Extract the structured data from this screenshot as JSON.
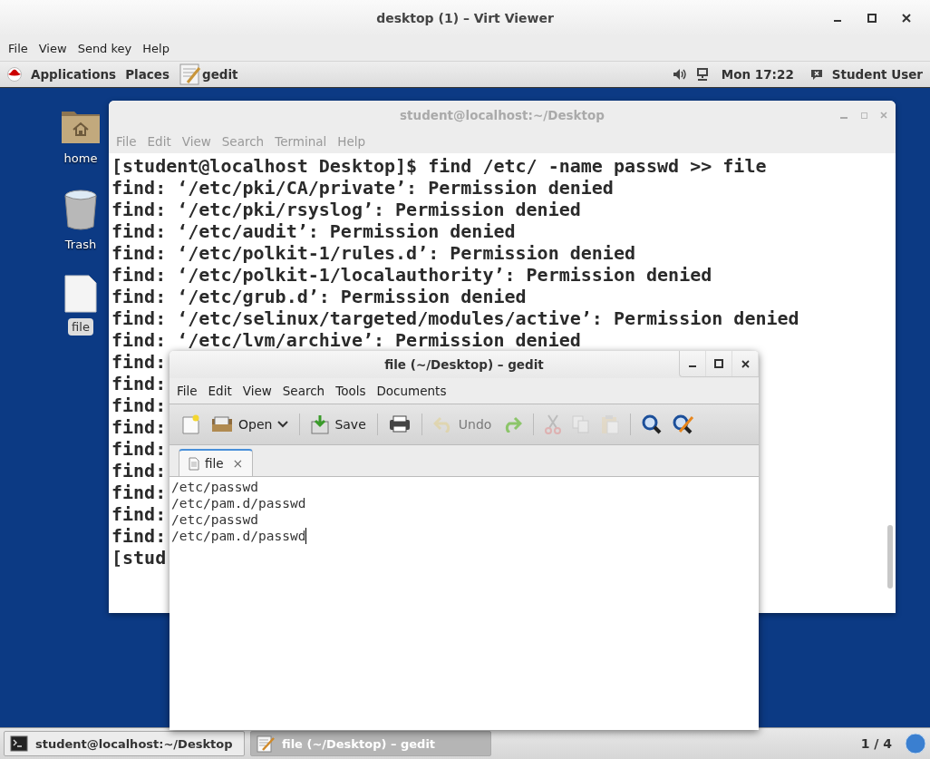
{
  "window": {
    "title": "desktop (1) – Virt Viewer",
    "menu": [
      "File",
      "View",
      "Send key",
      "Help"
    ]
  },
  "top_bar": {
    "applications": "Applications",
    "places": "Places",
    "app": "gedit",
    "clock": "Mon 17:22",
    "user": "Student User"
  },
  "desktop_icons": [
    {
      "kind": "folder",
      "label": "home",
      "selected": false
    },
    {
      "kind": "trash",
      "label": "Trash",
      "selected": false
    },
    {
      "kind": "file",
      "label": "file",
      "selected": true
    }
  ],
  "terminal": {
    "title": "student@localhost:~/Desktop",
    "menu": [
      "File",
      "Edit",
      "View",
      "Search",
      "Terminal",
      "Help"
    ],
    "lines": [
      "[student@localhost Desktop]$ find /etc/ -name passwd >> file",
      "find: ‘/etc/pki/CA/private’: Permission denied",
      "find: ‘/etc/pki/rsyslog’: Permission denied",
      "find: ‘/etc/audit’: Permission denied",
      "find: ‘/etc/polkit-1/rules.d’: Permission denied",
      "find: ‘/etc/polkit-1/localauthority’: Permission denied",
      "find: ‘/etc/grub.d’: Permission denied",
      "find: ‘/etc/selinux/targeted/modules/active’: Permission denied",
      "find: ‘/etc/lvm/archive’: Permission denied",
      "find:",
      "find:",
      "find:",
      "find:",
      "find:",
      "find:",
      "find:",
      "find:",
      "find:",
      "[stud"
    ]
  },
  "gedit": {
    "title": "file (~/Desktop) – gedit",
    "menu": [
      "File",
      "Edit",
      "View",
      "Search",
      "Tools",
      "Documents"
    ],
    "toolbar": [
      {
        "kind": "new",
        "disabled": false
      },
      {
        "kind": "open",
        "label": "Open",
        "disabled": false
      },
      {
        "kind": "save",
        "label": "Save",
        "disabled": false
      },
      {
        "kind": "print",
        "disabled": false
      },
      {
        "kind": "undo",
        "label": "Undo",
        "disabled": true
      },
      {
        "kind": "redo",
        "disabled": false
      },
      {
        "kind": "cut",
        "disabled": true
      },
      {
        "kind": "copy",
        "disabled": true
      },
      {
        "kind": "paste",
        "disabled": true
      },
      {
        "kind": "find",
        "disabled": false
      },
      {
        "kind": "replace",
        "disabled": false
      }
    ],
    "tabs": [
      {
        "label": "file",
        "close": "×",
        "selected": true
      }
    ],
    "lines": [
      "/etc/passwd",
      "/etc/pam.d/passwd",
      "/etc/passwd",
      "/etc/pam.d/passwd"
    ]
  },
  "taskbar": {
    "items": [
      {
        "kind": "terminal",
        "label": "student@localhost:~/Desktop",
        "selected": false
      },
      {
        "kind": "editor",
        "label": "file (~/Desktop) – gedit",
        "selected": true
      }
    ],
    "workspace": "1 / 4"
  }
}
